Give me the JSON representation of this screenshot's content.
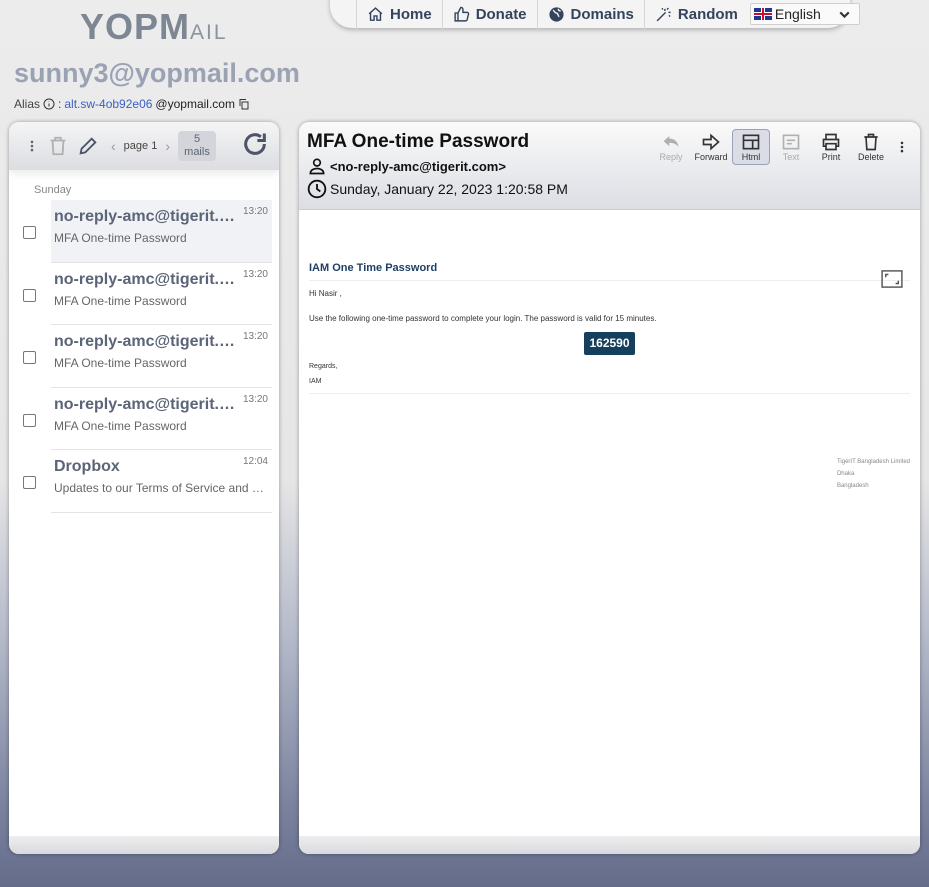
{
  "logo": {
    "text_main": "YOPM",
    "text_tail": "AIL"
  },
  "nav": {
    "items": [
      {
        "label": "Home",
        "icon": "home-icon"
      },
      {
        "label": "Donate",
        "icon": "thumbs-up-icon"
      },
      {
        "label": "Domains",
        "icon": "globe-icon"
      },
      {
        "label": "Random",
        "icon": "magic-wand-icon"
      }
    ],
    "language": "English"
  },
  "inbox": {
    "email": "sunny3@yopmail.com",
    "alias_label": "Alias",
    "alias_sep": ":",
    "alias_name": "alt.sw-4ob92e06",
    "alias_domain": "@yopmail.com"
  },
  "list": {
    "page": "page 1",
    "count": "5",
    "count_unit": "mails",
    "day": "Sunday",
    "mails": [
      {
        "from": "no-reply-amc@tigerit.com",
        "subject": "MFA One-time Password",
        "time": "13:20"
      },
      {
        "from": "no-reply-amc@tigerit.com",
        "subject": "MFA One-time Password",
        "time": "13:20"
      },
      {
        "from": "no-reply-amc@tigerit.com",
        "subject": "MFA One-time Password",
        "time": "13:20"
      },
      {
        "from": "no-reply-amc@tigerit.com",
        "subject": "MFA One-time Password",
        "time": "13:20"
      },
      {
        "from": "Dropbox",
        "subject": "Updates to our Terms of Service and Privacy Policy",
        "time": "12:04"
      }
    ]
  },
  "message": {
    "subject": "MFA One-time Password",
    "from": "<no-reply-amc@tigerit.com>",
    "date": "Sunday, January 22, 2023 1:20:58 PM",
    "actions": {
      "reply": "Reply",
      "forward": "Forward",
      "html": "Html",
      "text": "Text",
      "print": "Print",
      "delete": "Delete"
    },
    "body": {
      "heading": "IAM One Time Password",
      "greeting": "Hi Nasir ,",
      "instructions": "Use the following one-time password to complete your login. The password is valid for 15 minutes.",
      "otp": "162590",
      "regards": "Regards,",
      "signature": "IAM",
      "footer": [
        "TigerIT Bangladesh Limited",
        "Dhaka",
        "Bangladesh"
      ]
    }
  }
}
